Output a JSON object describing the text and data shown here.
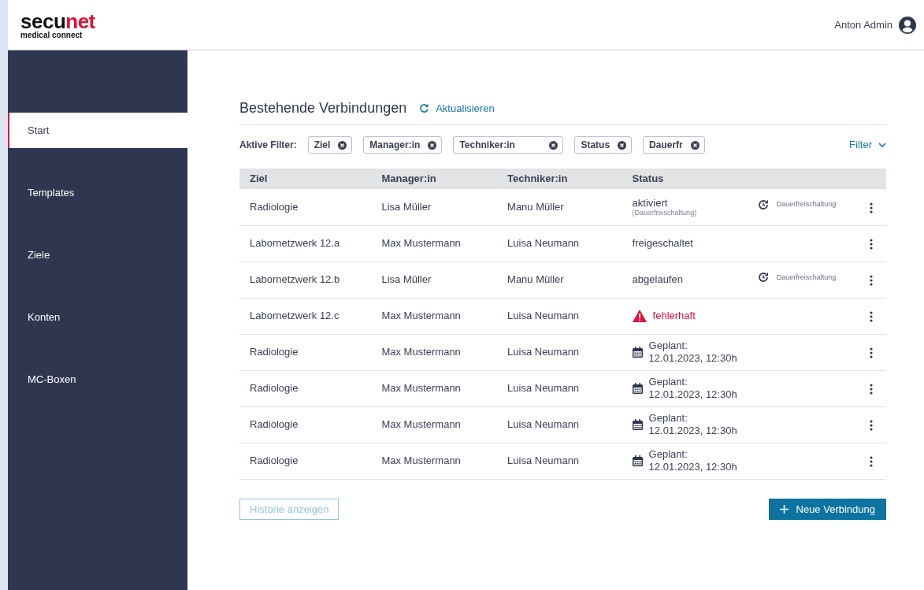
{
  "header": {
    "logo": {
      "parts": [
        "secu",
        "net"
      ],
      "tagline": "medical connect"
    },
    "user": "Anton Admin"
  },
  "sidebar": {
    "items": [
      {
        "label": "Start",
        "selected": true
      },
      {
        "label": "Templates",
        "selected": false
      },
      {
        "label": "Ziele",
        "selected": false
      },
      {
        "label": "Konten",
        "selected": false
      },
      {
        "label": "MC-Boxen",
        "selected": false
      }
    ]
  },
  "title": "Bestehende Verbindungen",
  "refresh": "Aktualisieren",
  "filters": {
    "label": "Aktive Filter:",
    "chips": [
      "Ziel",
      "Manager:in",
      "Techniker:in",
      "Status",
      "Dauerfr"
    ],
    "toggle": "Filter"
  },
  "table": {
    "columns": [
      "Ziel",
      "Manager:in",
      "Techniker:in",
      "Status"
    ],
    "rows": [
      {
        "ziel": "Radiologie",
        "manager": "Lisa Müller",
        "techniker": "Manu Müller",
        "status": {
          "kind": "text",
          "text": "aktiviert",
          "note": "(Dauerfreischaltung)"
        },
        "tag": "Dauerfreischaltung"
      },
      {
        "ziel": "Labornetzwerk 12.a",
        "manager": "Max Mustermann",
        "techniker": "Luisa Neumann",
        "status": {
          "kind": "text",
          "text": "freigeschaltet"
        }
      },
      {
        "ziel": "Labornetzwerk 12.b",
        "manager": "Lisa Müller",
        "techniker": "Manu Müller",
        "status": {
          "kind": "text",
          "text": "abgelaufen"
        },
        "tag": "Dauerfreischaltung"
      },
      {
        "ziel": "Labornetzwerk 12.c",
        "manager": "Max Mustermann",
        "techniker": "Luisa Neumann",
        "status": {
          "kind": "error",
          "text": "fehlerhaft"
        }
      },
      {
        "ziel": "Radiologie",
        "manager": "Max Mustermann",
        "techniker": "Luisa Neumann",
        "status": {
          "kind": "scheduled",
          "text": "Geplant:",
          "note": "12.01.2023, 12:30h"
        }
      },
      {
        "ziel": "Radiologie",
        "manager": "Max Mustermann",
        "techniker": "Luisa Neumann",
        "status": {
          "kind": "scheduled",
          "text": "Geplant:",
          "note": "12.01.2023, 12:30h"
        }
      },
      {
        "ziel": "Radiologie",
        "manager": "Max Mustermann",
        "techniker": "Luisa Neumann",
        "status": {
          "kind": "scheduled",
          "text": "Geplant:",
          "note": "12.01.2023, 12:30h"
        }
      },
      {
        "ziel": "Radiologie",
        "manager": "Max Mustermann",
        "techniker": "Luisa Neumann",
        "status": {
          "kind": "scheduled",
          "text": "Geplant:",
          "note": "12.01.2023, 12:30h"
        }
      }
    ]
  },
  "buttons": {
    "history": {
      "label": "Historie anzeigen",
      "disabled": true
    },
    "new": {
      "label": "Neue Verbindung",
      "disabled": false
    }
  }
}
